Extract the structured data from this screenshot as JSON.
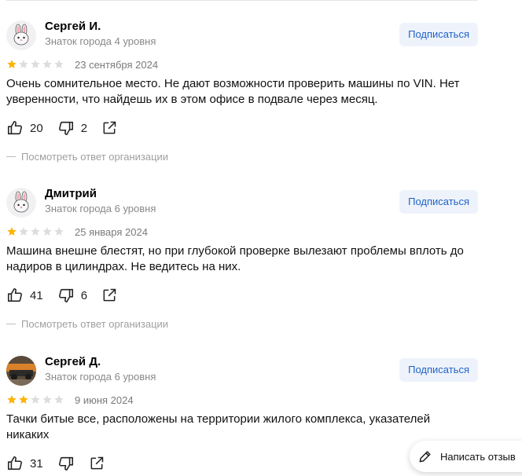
{
  "reviews": [
    {
      "author": "Сергей И.",
      "level": "Знаток города 4 уровня",
      "subscribe": "Подписаться",
      "rating": 1,
      "date": "23 сентября 2024",
      "text": "Очень сомнительное место. Не дают возможности проверить машины по VIN. Нет уверенности, что найдешь их в этом офисе в подвале через месяц.",
      "likes": "20",
      "dislikes": "2",
      "org_reply": "Посмотреть ответ организации",
      "avatar": "bunny-avatar-icon"
    },
    {
      "author": "Дмитрий",
      "level": "Знаток города 6 уровня",
      "subscribe": "Подписаться",
      "rating": 1,
      "date": "25 января 2024",
      "text": "Машина внешне блестят, но при глубокой проверке вылезают проблемы вплоть до надиров в цилиндрах. Не ведитесь на них.",
      "likes": "41",
      "dislikes": "6",
      "org_reply": "Посмотреть ответ организации",
      "avatar": "bunny-avatar-icon"
    },
    {
      "author": "Сергей Д.",
      "level": "Знаток города 6 уровня",
      "subscribe": "Подписаться",
      "rating": 2,
      "date": "9 июня 2024",
      "text": "Тачки битые все, расположены на территории жилого комплекса, указателей никаких",
      "likes": "31",
      "dislikes": "",
      "avatar": "photo-avatar"
    }
  ],
  "write_review": "Написать отзыв",
  "colors": {
    "star_filled": "#fcb400",
    "star_empty": "#dddddd",
    "subscribe_bg": "#eef3fb",
    "subscribe_text": "#1f62c7"
  }
}
